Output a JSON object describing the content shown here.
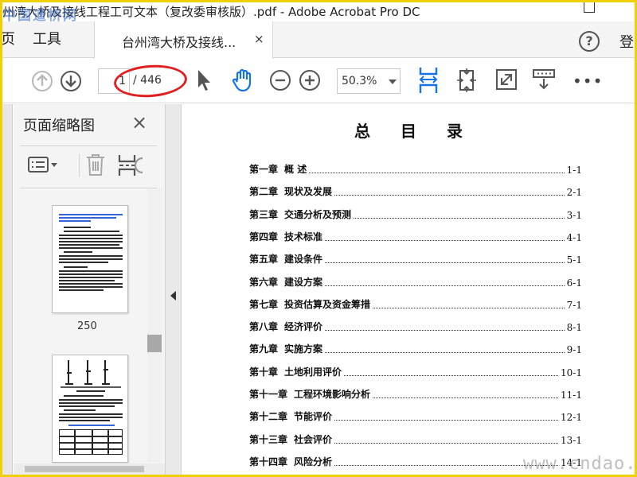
{
  "window": {
    "title": "州湾大桥及接线工程工可文本（复改委审核版）.pdf - Adobe Acrobat Pro DC",
    "watermark_text": "中国道桥网"
  },
  "tabs": {
    "home_label": "页",
    "tools_label": "工具",
    "document_label": "台州湾大桥及接线...",
    "close_glyph": "×",
    "help_glyph": "?",
    "signin_label": "登"
  },
  "toolbar": {
    "current_page": "1",
    "total_pages": "/ 446",
    "zoom": "50.3%",
    "more_glyph": "•••"
  },
  "sidebar": {
    "title": "页面缩略图",
    "close_glyph": "×",
    "thumbnail_label": "250"
  },
  "document": {
    "title": "总目录",
    "toc": [
      {
        "chapter": "第一章",
        "name": "概  述",
        "page": "1-1"
      },
      {
        "chapter": "第二章",
        "name": "现状及发展",
        "page": "2-1"
      },
      {
        "chapter": "第三章",
        "name": "交通分析及预测",
        "page": "3-1"
      },
      {
        "chapter": "第四章",
        "name": "技术标准",
        "page": "4-1"
      },
      {
        "chapter": "第五章",
        "name": "建设条件",
        "page": "5-1"
      },
      {
        "chapter": "第六章",
        "name": "建设方案",
        "page": "6-1"
      },
      {
        "chapter": "第七章",
        "name": "投资估算及资金筹措",
        "page": "7-1"
      },
      {
        "chapter": "第八章",
        "name": "经济评价",
        "page": "8-1"
      },
      {
        "chapter": "第九章",
        "name": "实施方案",
        "page": "9-1"
      },
      {
        "chapter": "第十章",
        "name": "土地利用评价",
        "page": "10-1"
      },
      {
        "chapter": "第十一章",
        "name": "工程环境影响分析",
        "page": "11-1"
      },
      {
        "chapter": "第十二章",
        "name": "节能评价",
        "page": "12-1"
      },
      {
        "chapter": "第十三章",
        "name": "社会评价",
        "page": "13-1"
      },
      {
        "chapter": "第十四章",
        "name": "风险分析",
        "page": "14-1"
      }
    ]
  },
  "site_watermark": "www.cndao.com",
  "colors": {
    "frame_border": "#f0d000",
    "annotation_red": "#e02020",
    "acrobat_blue": "#1473e6"
  }
}
